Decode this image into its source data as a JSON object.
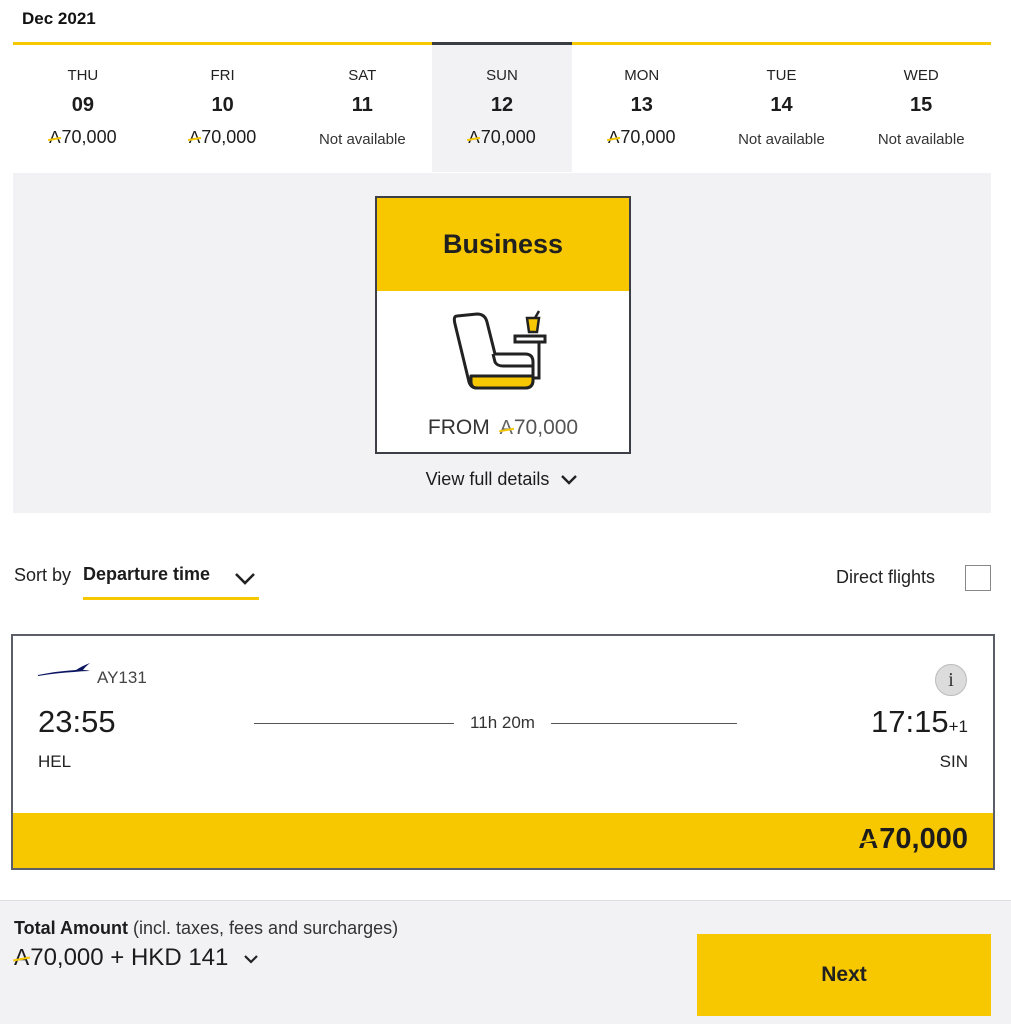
{
  "month": "Dec 2021",
  "currency_symbol": "A",
  "dates": [
    {
      "dow": "THU",
      "day": "09",
      "price": "70,000",
      "available": true,
      "selected": false
    },
    {
      "dow": "FRI",
      "day": "10",
      "price": "70,000",
      "available": true,
      "selected": false
    },
    {
      "dow": "SAT",
      "day": "11",
      "price": "Not available",
      "available": false,
      "selected": false
    },
    {
      "dow": "SUN",
      "day": "12",
      "price": "70,000",
      "available": true,
      "selected": true
    },
    {
      "dow": "MON",
      "day": "13",
      "price": "70,000",
      "available": true,
      "selected": false
    },
    {
      "dow": "TUE",
      "day": "14",
      "price": "Not available",
      "available": false,
      "selected": false
    },
    {
      "dow": "WED",
      "day": "15",
      "price": "Not available",
      "available": false,
      "selected": false
    }
  ],
  "cabin": {
    "name": "Business",
    "from_label": "FROM",
    "price": "70,000",
    "details_label": "View full details"
  },
  "sort": {
    "label": "Sort by",
    "value": "Departure time"
  },
  "direct_flights": {
    "label": "Direct flights",
    "checked": false
  },
  "flight": {
    "number": "AY131",
    "dep_time": "23:55",
    "dep_code": "HEL",
    "arr_time": "17:15",
    "day_offset": "+1",
    "arr_code": "SIN",
    "duration": "11h 20m",
    "price": "70,000"
  },
  "footer": {
    "total_label": "Total Amount",
    "total_note": "(incl. taxes, fees and surcharges)",
    "total_value": "70,000 + HKD 141",
    "next_label": "Next"
  },
  "colors": {
    "accent": "#f7c800",
    "border_dark": "#3d3f47",
    "panel_bg": "#f2f2f4",
    "brand_navy": "#0b1560"
  },
  "icons": [
    "avios-currency-icon",
    "business-seat-icon",
    "chevron-down-icon",
    "finnair-logo-icon",
    "info-icon",
    "checkbox-icon"
  ]
}
